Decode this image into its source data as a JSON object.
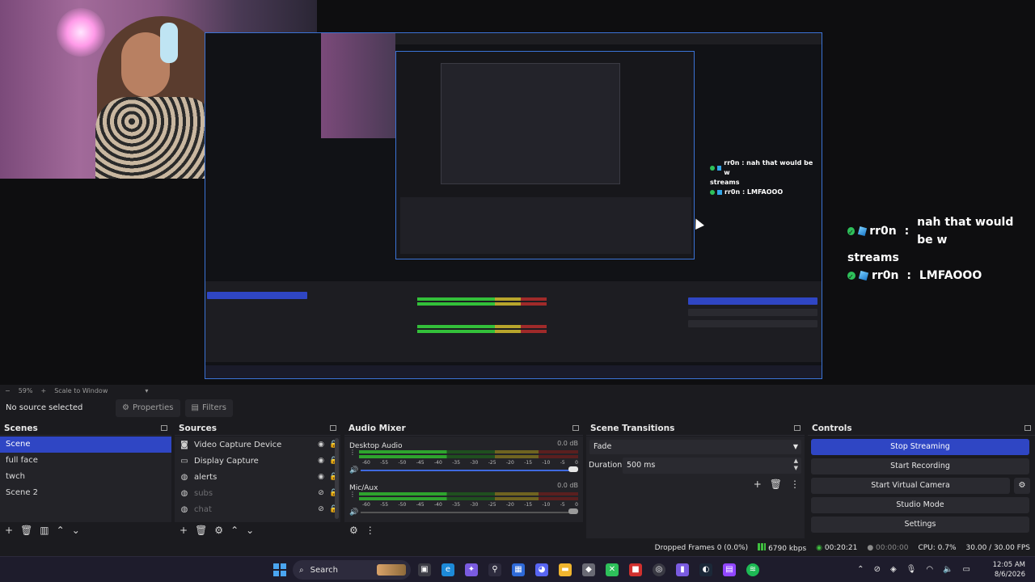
{
  "window": {
    "minimize": "—",
    "maximize": "❐",
    "close": "✕"
  },
  "preview": {
    "chat": [
      {
        "user": "rr0n",
        "message": "nah that would be w",
        "cont": "streams"
      },
      {
        "user": "rr0n",
        "message": "LMFAOOO",
        "cont": ""
      }
    ],
    "nested_chat": [
      {
        "text": "rr0n : nah that would be w"
      },
      {
        "text": "streams"
      },
      {
        "text": "rr0n : LMFAOOO"
      }
    ]
  },
  "zoom": {
    "minus": "−",
    "value": "59%",
    "plus": "+",
    "mode": "Scale to Window",
    "caret": "▾"
  },
  "source_toolbar": {
    "no_source": "No source selected",
    "properties": "Properties",
    "filters": "Filters"
  },
  "scenes": {
    "title": "Scenes",
    "items": [
      "Scene",
      "full face",
      "twch",
      "Scene 2"
    ],
    "selected": 0
  },
  "sources": {
    "title": "Sources",
    "items": [
      {
        "name": "Video Capture Device",
        "icon": "camera-icon",
        "visible": true
      },
      {
        "name": "Display Capture",
        "icon": "monitor-icon",
        "visible": true
      },
      {
        "name": "alerts",
        "icon": "globe-icon",
        "visible": true
      },
      {
        "name": "subs",
        "icon": "globe-icon",
        "visible": false
      },
      {
        "name": "chat",
        "icon": "globe-icon",
        "visible": false
      }
    ]
  },
  "mixer": {
    "title": "Audio Mixer",
    "channels": [
      {
        "name": "Desktop Audio",
        "db": "0.0 dB"
      },
      {
        "name": "Mic/Aux",
        "db": "0.0 dB"
      }
    ],
    "ticks": [
      "-60",
      "-55",
      "-50",
      "-45",
      "-40",
      "-35",
      "-30",
      "-25",
      "-20",
      "-15",
      "-10",
      "-5",
      "0"
    ]
  },
  "transitions": {
    "title": "Scene Transitions",
    "selected": "Fade",
    "duration_label": "Duration",
    "duration_value": "500 ms"
  },
  "controls": {
    "title": "Controls",
    "stop_streaming": "Stop Streaming",
    "start_recording": "Start Recording",
    "start_virtual_camera": "Start Virtual Camera",
    "studio_mode": "Studio Mode",
    "settings": "Settings"
  },
  "status": {
    "dropped": "Dropped Frames 0 (0.0%)",
    "bitrate": "6790 kbps",
    "stream_time": "00:20:21",
    "rec_time": "00:00:00",
    "cpu": "CPU: 0.7%",
    "fps": "30.00 / 30.00 FPS"
  },
  "taskbar": {
    "search": "Search",
    "time": "12:05 AM",
    "date": "8/6/2026"
  },
  "colors": {
    "accent": "#2f46c4",
    "panel": "#1b1b1f",
    "green": "#2ec05a"
  }
}
